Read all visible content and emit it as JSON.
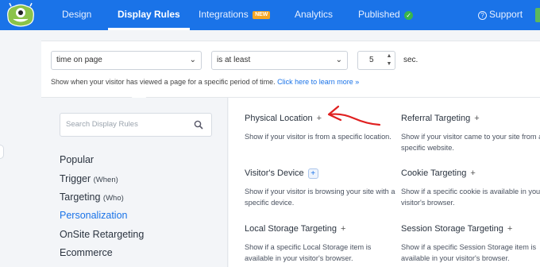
{
  "colors": {
    "brand": "#1a73e8",
    "badge": "#f5a623",
    "success": "#39b54a",
    "arrow": "#e02020"
  },
  "nav": {
    "tabs": [
      {
        "label": "Design"
      },
      {
        "label": "Display Rules",
        "active": true
      },
      {
        "label": "Integrations",
        "badge": "NEW"
      },
      {
        "label": "Analytics"
      },
      {
        "label": "Published",
        "icon": "check-circle-icon"
      }
    ],
    "support_label": "Support"
  },
  "rule": {
    "condition": "time on page",
    "operator": "is at least",
    "value": "5",
    "unit": "sec.",
    "help_text": "Show when your visitor has viewed a page for a specific period of time.",
    "help_link": "Click here to learn more »"
  },
  "sidebar": {
    "search_placeholder": "Search Display Rules",
    "categories": [
      {
        "label": "Popular",
        "sub": ""
      },
      {
        "label": "Trigger",
        "sub": "(When)"
      },
      {
        "label": "Targeting",
        "sub": "(Who)"
      },
      {
        "label": "Personalization",
        "sub": "",
        "active": true
      },
      {
        "label": "OnSite Retargeting",
        "sub": ""
      },
      {
        "label": "Ecommerce",
        "sub": ""
      }
    ]
  },
  "rules": [
    {
      "title": "Physical Location",
      "desc": "Show if your visitor is from a specific location."
    },
    {
      "title": "Referral Targeting",
      "desc": "Show if your visitor came to your site from a specific website."
    },
    {
      "title": "Visitor's Device",
      "desc": "Show if your visitor is browsing your site with a specific device."
    },
    {
      "title": "Cookie Targeting",
      "desc": "Show if a specific cookie is available in your visitor's browser."
    },
    {
      "title": "Local Storage Targeting",
      "desc": "Show if a specific Local Storage item is available in your visitor's browser."
    },
    {
      "title": "Session Storage Targeting",
      "desc": "Show if a specific Session Storage item is available in your visitor's browser."
    }
  ]
}
